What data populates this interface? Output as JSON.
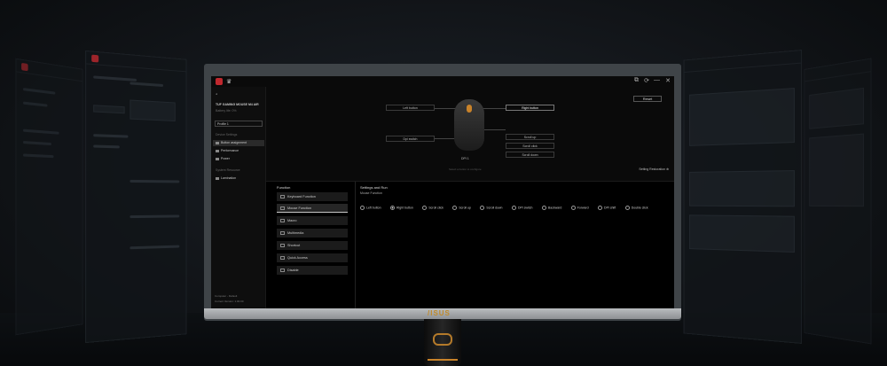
{
  "app": {
    "device_name": "TUF GAMING MOUSE M4 AIR",
    "battery": "Battery life: 0%",
    "profile": "Profile 1",
    "reset_label": "Reset",
    "window_controls": [
      "⧉",
      "⟳",
      "—",
      "✕"
    ]
  },
  "sidebar": {
    "section1": "Device Settings",
    "items": [
      {
        "label": "Button assignment",
        "active": true
      },
      {
        "label": "Performance",
        "active": false
      },
      {
        "label": "Power",
        "active": false
      }
    ],
    "section2": "System Resource",
    "items2": [
      {
        "label": "Lamination"
      }
    ],
    "footer_line1": "Computer - Default",
    "footer_line2": "Current Version: 1.00.00"
  },
  "mouse_map": {
    "left_button": "Left button",
    "right_button": "Right button",
    "dpi_switch": "Dpi switch",
    "scroll_up": "Scroll up",
    "scroll_click": "Scroll click",
    "scroll_down": "Scroll down",
    "dpi_readout": "DPI 1",
    "hint": "Select a button to configure",
    "restore": "Setting Restoration"
  },
  "functions": {
    "title": "Function",
    "items": [
      {
        "label": "Keyboard Function",
        "icon": "keyboard-icon"
      },
      {
        "label": "Mouse Function",
        "icon": "mouse-icon",
        "active": true
      },
      {
        "label": "Macro",
        "icon": "macro-icon"
      },
      {
        "label": "Multimedia",
        "icon": "multimedia-icon"
      },
      {
        "label": "Shortcut",
        "icon": "shortcut-icon"
      },
      {
        "label": "Quick Access",
        "icon": "quick-access-icon"
      },
      {
        "label": "Disable",
        "icon": "disable-icon"
      }
    ]
  },
  "settings": {
    "title": "Settings and Run",
    "subtitle": "Mouse Function",
    "options": [
      {
        "label": "Left button",
        "selected": false
      },
      {
        "label": "Right button",
        "selected": true
      },
      {
        "label": "Scroll click",
        "selected": false
      },
      {
        "label": "Scroll up",
        "selected": false
      },
      {
        "label": "Scroll down",
        "selected": false
      },
      {
        "label": "DPI switch",
        "selected": false
      },
      {
        "label": "Backward",
        "selected": false
      },
      {
        "label": "Forward",
        "selected": false
      },
      {
        "label": "DPI shift",
        "selected": false
      },
      {
        "label": "Double click",
        "selected": false
      }
    ]
  },
  "brand": "/ISUS",
  "colors": {
    "accent": "#c0282e",
    "gold": "#c9832a"
  }
}
